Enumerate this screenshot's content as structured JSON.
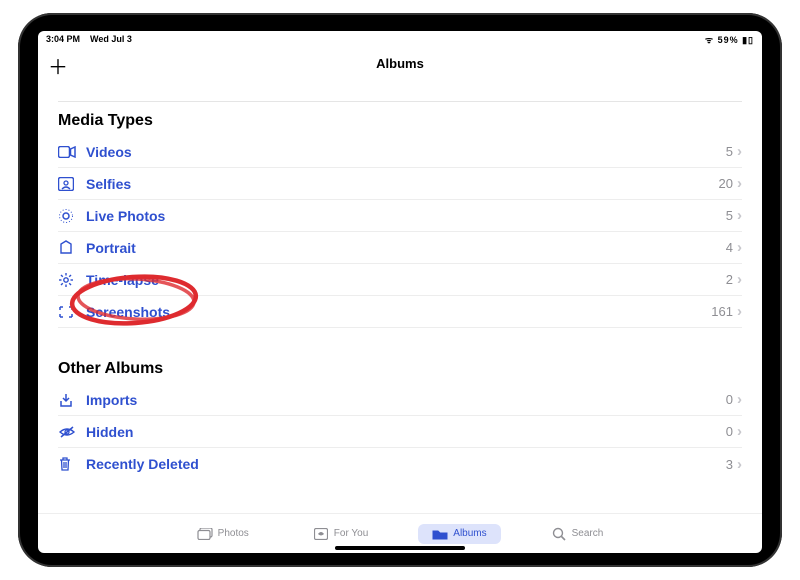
{
  "statusBar": {
    "time": "3:04 PM",
    "date": "Wed Jul 3",
    "battery": "59%"
  },
  "nav": {
    "title": "Albums",
    "plus": "＋"
  },
  "sections": [
    {
      "header": "Media Types",
      "items": [
        {
          "icon": "video",
          "label": "Videos",
          "count": "5"
        },
        {
          "icon": "selfie",
          "label": "Selfies",
          "count": "20"
        },
        {
          "icon": "live",
          "label": "Live Photos",
          "count": "5"
        },
        {
          "icon": "portrait",
          "label": "Portrait",
          "count": "4"
        },
        {
          "icon": "timelapse",
          "label": "Time-lapse",
          "count": "2"
        },
        {
          "icon": "screenshot",
          "label": "Screenshots",
          "count": "161"
        }
      ]
    },
    {
      "header": "Other Albums",
      "items": [
        {
          "icon": "imports",
          "label": "Imports",
          "count": "0"
        },
        {
          "icon": "hidden",
          "label": "Hidden",
          "count": "0"
        },
        {
          "icon": "trash",
          "label": "Recently Deleted",
          "count": "3"
        }
      ]
    }
  ],
  "tabs": [
    {
      "icon": "photos-tab",
      "label": "Photos",
      "active": false
    },
    {
      "icon": "foryou-tab",
      "label": "For You",
      "active": false
    },
    {
      "icon": "albums-tab",
      "label": "Albums",
      "active": true
    },
    {
      "icon": "search-tab",
      "label": "Search",
      "active": false
    }
  ],
  "annotation": {
    "circledItem": "Time-lapse"
  }
}
